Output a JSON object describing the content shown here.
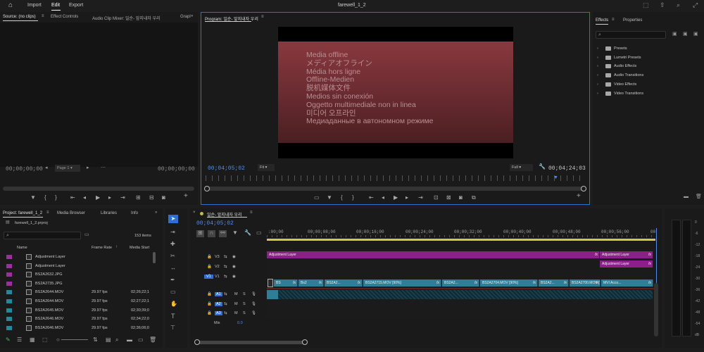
{
  "menu": {
    "home_icon": "home-icon",
    "items": [
      "Import",
      "Edit",
      "Export"
    ],
    "active": "Edit",
    "project_title": "farewell_1_2"
  },
  "source_panel": {
    "tabs": [
      "Source: (no clips)",
      "Effect Controls",
      "Audio Clip Mixer: 일순- 앞지내자 우리",
      "Grapl"
    ],
    "tc_left": "00;00;00;00",
    "tc_right": "00;00;00;00",
    "page_select": "Page 1"
  },
  "program_panel": {
    "tab": "Program: 일순- 앞지내자 우리",
    "offline_lines": [
      "Media offline",
      "メディアオフライン",
      "Média hors ligne",
      "Offline-Medien",
      "脱机媒体文件",
      "Medios sin conexión",
      "Oggetto multimediale non in linea",
      "미디어 오프라인",
      "Медиаданные в автономном режиме"
    ],
    "tc_current": "00;04;05;02",
    "fit_select": "Fit",
    "full_select": "Full",
    "tc_duration": "00;04;24;03"
  },
  "effects_panel": {
    "tabs": [
      "Effects",
      "Properties"
    ],
    "items": [
      "Presets",
      "Lumetri Presets",
      "Audio Effects",
      "Audio Transitions",
      "Video Effects",
      "Video Transitions"
    ]
  },
  "project_panel": {
    "tabs": [
      "Project: farewell_1_2",
      "Media Browser",
      "Libraries",
      "Info"
    ],
    "file": "farewell_1_2.prproj",
    "item_count": "153 items",
    "columns": {
      "name": "Name",
      "frame_rate": "Frame Rate",
      "media_start": "Media Start"
    },
    "rows": [
      {
        "name": "Adjustment Layer",
        "fps": "",
        "start": "",
        "color": "#9c2fa0"
      },
      {
        "name": "Adjustment Layer",
        "fps": "",
        "start": "",
        "color": "#9c2fa0"
      },
      {
        "name": "BS2A2632.JPG",
        "fps": "",
        "start": "",
        "color": "#9c2fa0"
      },
      {
        "name": "BS2A2735.JPG",
        "fps": "",
        "start": "",
        "color": "#9c2fa0"
      },
      {
        "name": "BS2A2644.MOV",
        "fps": "29.97 fps",
        "start": "02;26;22;1",
        "color": "#1f8a9c"
      },
      {
        "name": "BS2A2644.MOV",
        "fps": "29.97 fps",
        "start": "02;27;22;1",
        "color": "#1f8a9c"
      },
      {
        "name": "BS2A2645.MOV",
        "fps": "29.97 fps",
        "start": "02;30;39;0",
        "color": "#1f8a9c"
      },
      {
        "name": "BS2A2646.MOV",
        "fps": "29.97 fps",
        "start": "02;34;22;0",
        "color": "#1f8a9c"
      },
      {
        "name": "BS2A2646.MOV",
        "fps": "29.97 fps",
        "start": "02;36;06;0",
        "color": "#1f8a9c"
      }
    ]
  },
  "timeline": {
    "tab": "일순- 앞지내자 우리",
    "tc": "00;04;05;02",
    "ruler": [
      ":00;00",
      "00;00;08;00",
      "00;00;16;00",
      "00;00;24;00",
      "00;00;32;00",
      "00;00;40;00",
      "00;00;48;00",
      "00;00;56;00",
      "00"
    ],
    "video_tracks": [
      "V3",
      "V2",
      "V1"
    ],
    "audio_tracks": [
      "A1",
      "A2",
      "A3"
    ],
    "mix_label": "Mix",
    "mix_value": "0.0",
    "adj_label": "Adjustment Layer",
    "v1_clips": [
      "BS",
      "Bs2",
      "BS2A2...",
      "BS2A2715.MOV [90%]",
      "BS2A2...",
      "BS2A2704.MOV [90%]",
      "BS2A2...",
      "BS2A2700.MOV [90%]",
      "MVI Acco..."
    ]
  },
  "meter": {
    "scale": [
      "0",
      "-6",
      "-12",
      "-18",
      "-24",
      "-30",
      "-36",
      "-42",
      "-48",
      "-54",
      "dB"
    ]
  }
}
